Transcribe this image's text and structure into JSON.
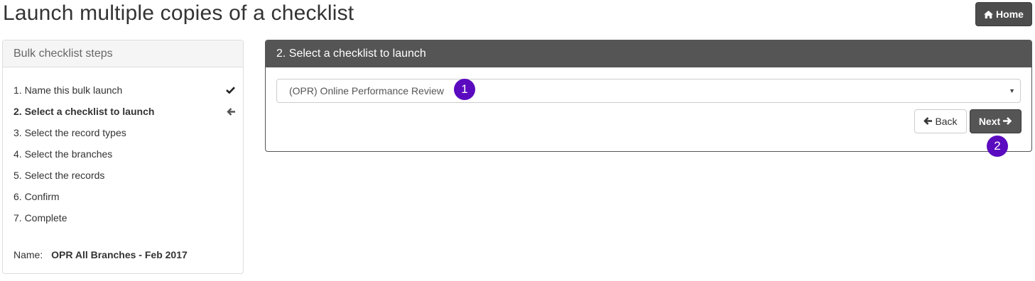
{
  "page": {
    "title": "Launch multiple copies of a checklist",
    "home_label": "Home"
  },
  "steps_panel": {
    "header": "Bulk checklist steps",
    "steps": [
      {
        "label": "1. Name this bulk launch",
        "status_icon": "check-icon"
      },
      {
        "label": "2. Select a checklist to launch",
        "status_icon": "arrow-left-icon",
        "active": true
      },
      {
        "label": "3. Select the record types"
      },
      {
        "label": "4. Select the branches"
      },
      {
        "label": "5. Select the records"
      },
      {
        "label": "6. Confirm"
      },
      {
        "label": "7. Complete"
      }
    ],
    "name_label": "Name:",
    "name_value": "OPR All Branches - Feb 2017"
  },
  "main_panel": {
    "header": "2. Select a checklist to launch",
    "select_value": "(OPR) Online Performance Review",
    "back_label": "Back",
    "next_label": "Next"
  },
  "markers": [
    "1",
    "2"
  ],
  "colors": {
    "panel_header_dark": "#555555",
    "marker": "#5b0bbf",
    "button_dark": "#4d4d4d"
  }
}
